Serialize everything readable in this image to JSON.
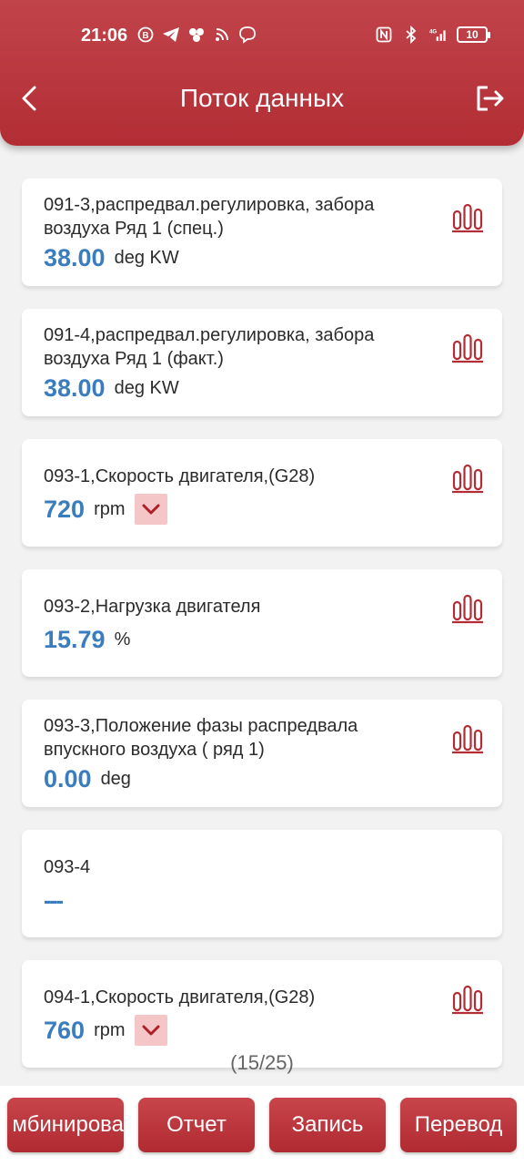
{
  "status_bar": {
    "time": "21:06",
    "battery": "10",
    "icons": [
      "b-icon",
      "telegram-icon",
      "dots-icon",
      "rss-icon",
      "viber-icon"
    ],
    "right_icons": [
      "nfc-icon",
      "bluetooth-icon",
      "signal-4g-icon"
    ]
  },
  "header": {
    "title": "Поток данных"
  },
  "items": [
    {
      "name": "091-3,распредвал.регулировка, забора воздуха Ряд 1 (спец.)",
      "value": "38.00",
      "unit": "deg KW",
      "dropdown": false,
      "chart": true
    },
    {
      "name": "091-4,распредвал.регулировка, забора воздуха Ряд 1 (факт.)",
      "value": "38.00",
      "unit": "deg KW",
      "dropdown": false,
      "chart": true
    },
    {
      "name": "093-1,Скорость двигателя,(G28)",
      "value": "720",
      "unit": "rpm",
      "dropdown": true,
      "chart": true
    },
    {
      "name": "093-2,Нагрузка двигателя",
      "value": "15.79",
      "unit": "%",
      "dropdown": false,
      "chart": true
    },
    {
      "name": "093-3,Положение фазы распредвала впускного воздуха ( ряд 1)",
      "value": "0.00",
      "unit": "deg",
      "dropdown": false,
      "chart": true
    },
    {
      "name": "093-4",
      "value": "---",
      "unit": "",
      "dropdown": false,
      "chart": false
    },
    {
      "name": "094-1,Скорость двигателя,(G28)",
      "value": "760",
      "unit": "rpm",
      "dropdown": true,
      "chart": true
    }
  ],
  "pager": "(15/25)",
  "footer": {
    "combine_label": "мбинирова",
    "report_label": "Отчет",
    "record_label": "Запись",
    "translate_label": "Перевод"
  },
  "colors": {
    "header": "#b22d34",
    "value": "#3a7dbf",
    "accent": "#b22d34",
    "dropdown_bg": "#f5c6c8"
  }
}
